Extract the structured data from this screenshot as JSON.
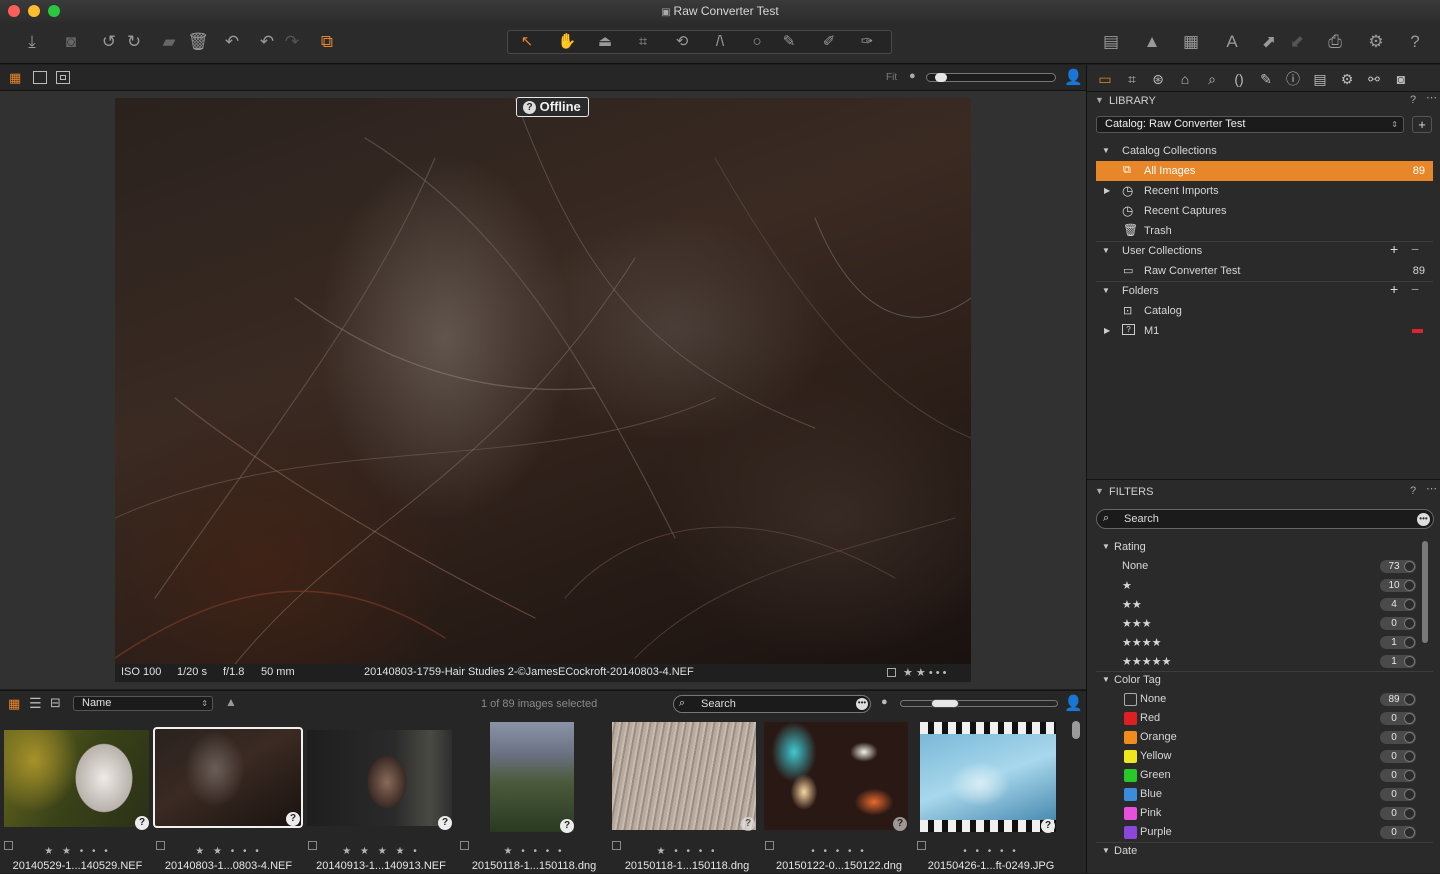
{
  "window": {
    "title": "Raw Converter Test"
  },
  "viewer": {
    "offline_label": "Offline",
    "fit_label": "Fit",
    "info": {
      "iso": "ISO 100",
      "shutter": "1/20 s",
      "aperture": "f/1.8",
      "focal": "50 mm",
      "filename": "20140803-1759-Hair Studies 2-©JamesECockroft-20140803-4.NEF",
      "rating": "★ ★ • • •"
    }
  },
  "browser": {
    "sort_label": "Name",
    "selection_text": "1 of 89 images selected",
    "search_placeholder": "Search"
  },
  "thumbnails": [
    {
      "name": "20140529-1...140529.NEF",
      "rating": "★ ★ • • •"
    },
    {
      "name": "20140803-1...0803-4.NEF",
      "rating": "★ ★ • • •"
    },
    {
      "name": "20140913-1...140913.NEF",
      "rating": "★ ★ ★ ★ •"
    },
    {
      "name": "20150118-1...150118.dng",
      "rating": "★ • • • •"
    },
    {
      "name": "20150118-1...150118.dng",
      "rating": "★ • • • •"
    },
    {
      "name": "20150122-0...150122.dng",
      "rating": "• • • • •"
    },
    {
      "name": "20150426-1...ft-0249.JPG",
      "rating": "• • • • •"
    }
  ],
  "library": {
    "title": "LIBRARY",
    "help": "?",
    "catalog_select": "Catalog: Raw Converter Test",
    "catalog_collections": "Catalog Collections",
    "items": [
      {
        "label": "All Images",
        "count": "89"
      },
      {
        "label": "Recent Imports",
        "count": ""
      },
      {
        "label": "Recent Captures",
        "count": ""
      },
      {
        "label": "Trash",
        "count": ""
      }
    ],
    "user_collections": "User Collections",
    "user_items": [
      {
        "label": "Raw Converter Test",
        "count": "89"
      }
    ],
    "folders": "Folders",
    "folder_items": [
      {
        "label": "Catalog"
      },
      {
        "label": "M1"
      }
    ]
  },
  "filters": {
    "title": "FILTERS",
    "help": "?",
    "search_placeholder": "Search",
    "rating_title": "Rating",
    "ratings": [
      {
        "label": "None",
        "count": "73"
      },
      {
        "label": "★",
        "count": "10"
      },
      {
        "label": "★★",
        "count": "4"
      },
      {
        "label": "★★★",
        "count": "0"
      },
      {
        "label": "★★★★",
        "count": "1"
      },
      {
        "label": "★★★★★",
        "count": "1"
      }
    ],
    "color_tag_title": "Color Tag",
    "color_tags": [
      {
        "label": "None",
        "count": "89",
        "color": "none"
      },
      {
        "label": "Red",
        "count": "0",
        "color": "#e02020"
      },
      {
        "label": "Orange",
        "count": "0",
        "color": "#f08c1e"
      },
      {
        "label": "Yellow",
        "count": "0",
        "color": "#f0e61e"
      },
      {
        "label": "Green",
        "count": "0",
        "color": "#28c828"
      },
      {
        "label": "Blue",
        "count": "0",
        "color": "#3c8cdc"
      },
      {
        "label": "Pink",
        "count": "0",
        "color": "#e650dc"
      },
      {
        "label": "Purple",
        "count": "0",
        "color": "#8c46dc"
      }
    ],
    "date_title": "Date"
  },
  "colors": {
    "accent": "#e8862a",
    "panel": "#2a2a2a"
  }
}
